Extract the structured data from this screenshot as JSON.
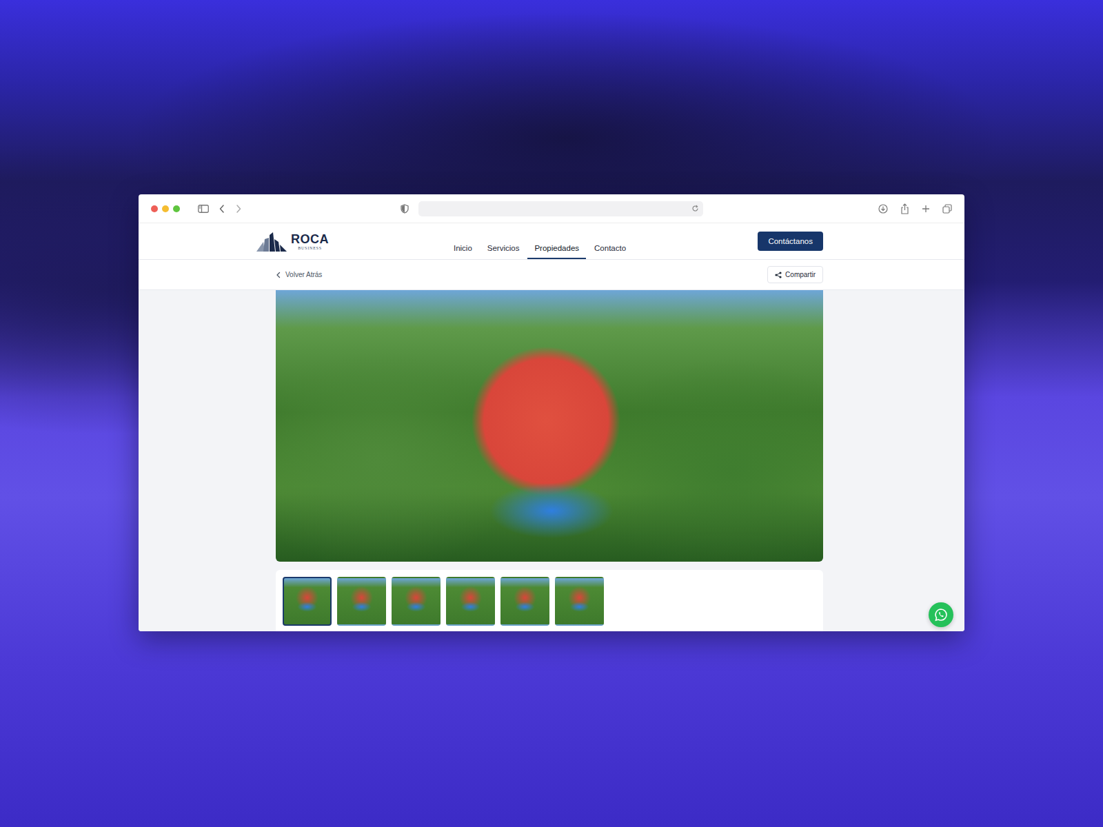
{
  "logo": {
    "name": "ROCA",
    "tagline": "BUSINESS"
  },
  "nav": [
    {
      "label": "Inicio",
      "selected": false
    },
    {
      "label": "Servicios",
      "selected": false
    },
    {
      "label": "Propiedades",
      "selected": true
    },
    {
      "label": "Contacto",
      "selected": false
    }
  ],
  "cta": "Contáctanos",
  "back": "Volver Atrás",
  "share": "Compartir",
  "gallery": {
    "thumbnails": [
      {
        "selected": true
      },
      {
        "selected": false
      },
      {
        "selected": false
      },
      {
        "selected": false
      },
      {
        "selected": false
      },
      {
        "selected": false
      }
    ]
  }
}
